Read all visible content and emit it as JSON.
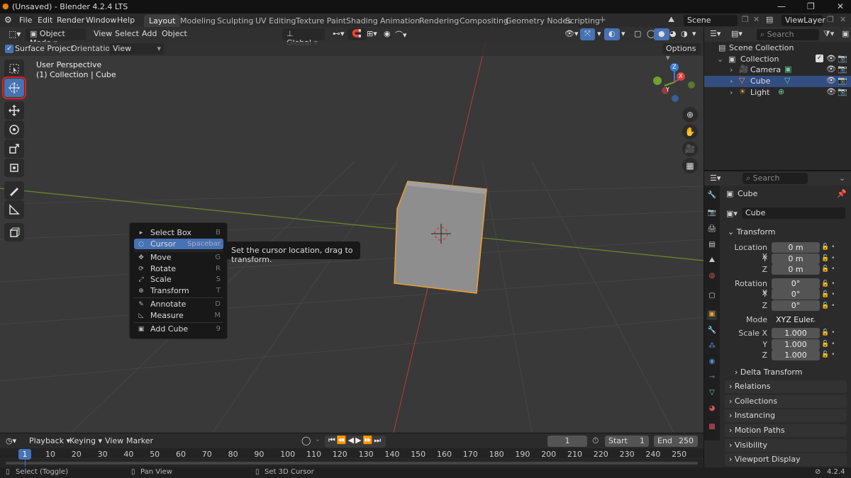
{
  "window": {
    "title": "(Unsaved) - Blender 4.2.4 LTS"
  },
  "menu": [
    "File",
    "Edit",
    "Render",
    "Window",
    "Help"
  ],
  "workspaces": [
    "Layout",
    "Modeling",
    "Sculpting",
    "UV Editing",
    "Texture Paint",
    "Shading",
    "Animation",
    "Rendering",
    "Compositing",
    "Geometry Nodes",
    "Scripting"
  ],
  "scene": {
    "name": "Scene",
    "view_layer": "ViewLayer"
  },
  "viewport_header": {
    "mode": "Object Mode",
    "menus": [
      "View",
      "Select",
      "Add",
      "Object"
    ],
    "transform_orientation": "Global"
  },
  "tool_settings": {
    "surface_project_label": "Surface Project",
    "surface_project": true,
    "orientation_label": "Orientation:",
    "orientation_value": "View",
    "options_label": "Options"
  },
  "overlay_text": {
    "line1": "User Perspective",
    "line2": "(1) Collection | Cube"
  },
  "gizmo_axes": {
    "x": "X",
    "y": "Y",
    "z": "Z"
  },
  "context_menu": {
    "items": [
      {
        "label": "Select Box",
        "shortcut": "B",
        "highlighted": false
      },
      {
        "label": "Cursor",
        "shortcut": "Spacebar",
        "highlighted": true
      },
      {
        "label": "Move",
        "shortcut": "G",
        "highlighted": false
      },
      {
        "label": "Rotate",
        "shortcut": "R",
        "highlighted": false
      },
      {
        "label": "Scale",
        "shortcut": "S",
        "highlighted": false
      },
      {
        "label": "Transform",
        "shortcut": "T",
        "highlighted": false
      },
      {
        "label": "Annotate",
        "shortcut": "D",
        "highlighted": false
      },
      {
        "label": "Measure",
        "shortcut": "M",
        "highlighted": false
      },
      {
        "label": "Add Cube",
        "shortcut": "9",
        "highlighted": false
      }
    ],
    "tooltip": "Set the cursor location, drag to transform."
  },
  "outliner": {
    "search_placeholder": "Search",
    "root": "Scene Collection",
    "collection": "Collection",
    "objects": [
      {
        "name": "Camera",
        "selected": false
      },
      {
        "name": "Cube",
        "selected": true
      },
      {
        "name": "Light",
        "selected": false
      }
    ]
  },
  "properties": {
    "search_placeholder": "Search",
    "object_name": "Cube",
    "object_field": "Cube",
    "transform_header": "Transform",
    "location": {
      "label": "Location X",
      "x": "0 m",
      "y": "0 m",
      "z": "0 m"
    },
    "rotation": {
      "label": "Rotation X",
      "x": "0°",
      "y": "0°",
      "z": "0°"
    },
    "mode": {
      "label": "Mode",
      "value": "XYZ Euler"
    },
    "scale": {
      "label": "Scale X",
      "x": "1.000",
      "y": "1.000",
      "z": "1.000"
    },
    "axis_labels": {
      "y": "Y",
      "z": "Z"
    },
    "delta_transform": "Delta Transform",
    "panels": [
      "Relations",
      "Collections",
      "Instancing",
      "Motion Paths",
      "Visibility",
      "Viewport Display"
    ]
  },
  "timeline": {
    "menus": [
      "Playback",
      "Keying",
      "View",
      "Marker"
    ],
    "current_frame": "1",
    "start_label": "Start",
    "start": "1",
    "end_label": "End",
    "end": "250",
    "ruler": [
      "10",
      "20",
      "30",
      "40",
      "50",
      "60",
      "70",
      "80",
      "90",
      "100",
      "110",
      "120",
      "130",
      "140",
      "150",
      "160",
      "170",
      "180",
      "190",
      "200",
      "210",
      "220",
      "230",
      "240",
      "250"
    ]
  },
  "statusbar": {
    "left": "Select (Toggle)",
    "middle": "Pan View",
    "right": "Set 3D Cursor",
    "version": "4.2.4"
  },
  "colors": {
    "accent": "#4772b3",
    "selection_outline": "#f0a030",
    "highlight_box": "#e02020"
  }
}
